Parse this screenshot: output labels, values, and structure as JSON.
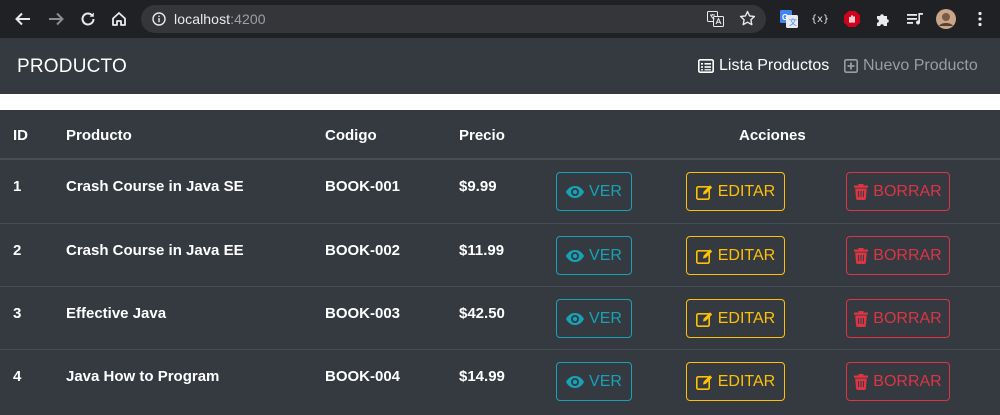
{
  "browser": {
    "url_host": "localhost",
    "url_port": ":4200"
  },
  "navbar": {
    "brand": "PRODUCTO",
    "links": [
      {
        "label": "Lista Productos",
        "icon": "list-icon"
      },
      {
        "label": "Nuevo Producto",
        "icon": "plus-square-icon"
      }
    ]
  },
  "table": {
    "headers": {
      "id": "ID",
      "producto": "Producto",
      "codigo": "Codigo",
      "precio": "Precio",
      "acciones": "Acciones"
    },
    "actions": {
      "ver": "VER",
      "editar": "EDITAR",
      "borrar": "BORRAR"
    },
    "rows": [
      {
        "id": "1",
        "producto": "Crash Course in Java SE",
        "codigo": "BOOK-001",
        "precio": "$9.99"
      },
      {
        "id": "2",
        "producto": "Crash Course in Java EE",
        "codigo": "BOOK-002",
        "precio": "$11.99"
      },
      {
        "id": "3",
        "producto": "Effective Java",
        "codigo": "BOOK-003",
        "precio": "$42.50"
      },
      {
        "id": "4",
        "producto": "Java How to Program",
        "codigo": "BOOK-004",
        "precio": "$14.99"
      }
    ]
  },
  "colors": {
    "navbar_bg": "#343a40",
    "info": "#17a2b8",
    "warning": "#ffc107",
    "danger": "#dc3545"
  }
}
